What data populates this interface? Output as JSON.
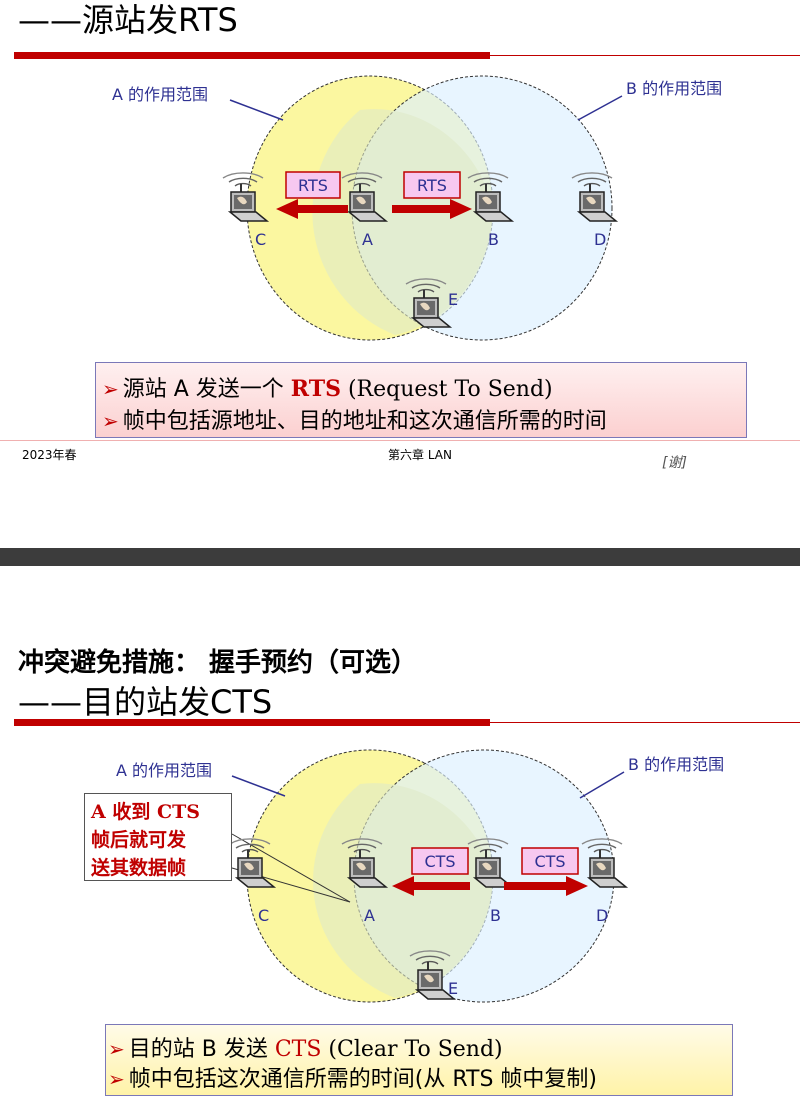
{
  "slide1": {
    "title": "——源站发RTS",
    "diagram": {
      "range_a_label": "A 的作用范围",
      "range_b_label": "B 的作用范围",
      "signal_label_1": "RTS",
      "signal_label_2": "RTS",
      "nodes": [
        "C",
        "A",
        "B",
        "D",
        "E"
      ]
    },
    "bullets": [
      {
        "prefix": "源站 A 发送一个 ",
        "highlight": "RTS",
        "suffix": " (Request To Send)"
      },
      {
        "prefix": "帧中包括源地址、目的地址和这次通信所需的时间",
        "highlight": "",
        "suffix": ""
      }
    ],
    "footer": {
      "left": "2023年春",
      "center": "第六章 LAN",
      "right": "[谢]"
    }
  },
  "slide2": {
    "title_line1": "冲突避免措施：  握手预约（可选）",
    "title_line2": "——目的站发CTS",
    "diagram": {
      "range_a_label": "A 的作用范围",
      "range_b_label": "B 的作用范围",
      "signal_label_1": "CTS",
      "signal_label_2": "CTS",
      "nodes": [
        "C",
        "A",
        "B",
        "D",
        "E"
      ]
    },
    "note": [
      "A 收到 CTS",
      "帧后就可发",
      "送其数据帧"
    ],
    "bullets": [
      {
        "prefix": "目的站 B 发送 ",
        "highlight": "CTS",
        "suffix": " (Clear To Send)"
      },
      {
        "prefix": "帧中包括这次通信所需的时间(从 RTS 帧中复制)",
        "highlight": "",
        "suffix": ""
      }
    ]
  },
  "colors": {
    "accent": "#c00000",
    "range_a": "#fbf7a0",
    "range_b": "#dcefff",
    "label_blue": "#2e3192"
  }
}
